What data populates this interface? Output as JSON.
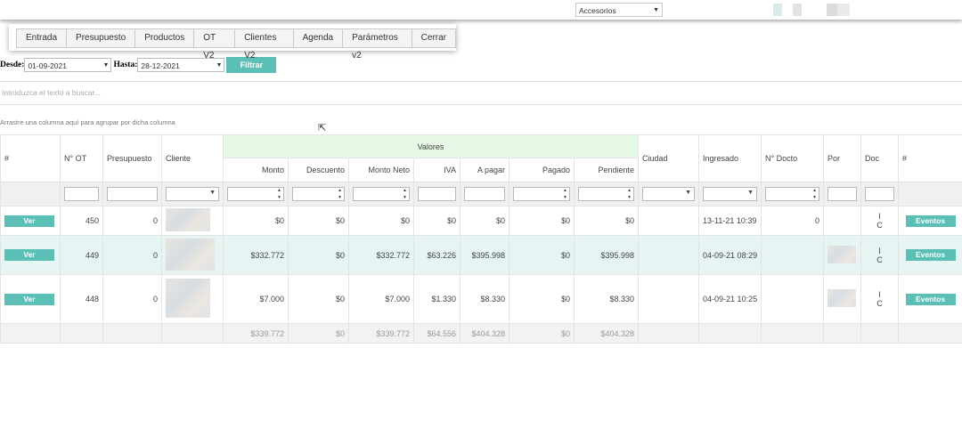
{
  "topbar": {
    "category": "Accesorios"
  },
  "menu": [
    "Entrada",
    "Presupuesto",
    "Productos",
    "OT V2",
    "Clientes V2",
    "Agenda",
    "Parámetros v2",
    "Cerrar"
  ],
  "filter": {
    "desde_label": "Desde:",
    "desde_value": "01-09-2021",
    "hasta_label": "Hasta:",
    "hasta_value": "28-12-2021",
    "button": "Filtrar"
  },
  "search_placeholder": "Introduzca el texto a buscar...",
  "group_hint": "Arrastre una columna aquí para agrupar por dicha columna",
  "headers": {
    "hash": "#",
    "ot": "N° OT",
    "presupuesto": "Presupuesto",
    "cliente": "Cliente",
    "valores": "Valores",
    "monto": "Monto",
    "descuento": "Descuento",
    "monto_neto": "Monto Neto",
    "iva": "IVA",
    "a_pagar": "A pagar",
    "pagado": "Pagado",
    "pendiente": "Pendiente",
    "ciudad": "Ciudad",
    "ingresado": "Ingresado",
    "n_docto": "N° Docto",
    "por": "Por",
    "doc": "Doc",
    "hash2": "#"
  },
  "rows": [
    {
      "ver": "Ver",
      "ot": "450",
      "presupuesto": "0",
      "monto": "$0",
      "descuento": "$0",
      "monto_neto": "$0",
      "iva": "$0",
      "a_pagar": "$0",
      "pagado": "$0",
      "pendiente": "$0",
      "ciudad": "",
      "ingresado": "13-11-21 10:39",
      "n_docto": "0",
      "doc": "I\nC",
      "eventos": "Eventos"
    },
    {
      "ver": "Ver",
      "ot": "449",
      "presupuesto": "0",
      "monto": "$332.772",
      "descuento": "$0",
      "monto_neto": "$332.772",
      "iva": "$63.226",
      "a_pagar": "$395.998",
      "pagado": "$0",
      "pendiente": "$395.998",
      "ciudad": "",
      "ingresado": "04-09-21 08:29",
      "n_docto": "",
      "doc": "I\nC",
      "eventos": "Eventos"
    },
    {
      "ver": "Ver",
      "ot": "448",
      "presupuesto": "0",
      "monto": "$7.000",
      "descuento": "$0",
      "monto_neto": "$7.000",
      "iva": "$1.330",
      "a_pagar": "$8.330",
      "pagado": "$0",
      "pendiente": "$8.330",
      "ciudad": "",
      "ingresado": "04-09-21 10:25",
      "n_docto": "",
      "doc": "I\nC",
      "eventos": "Eventos"
    }
  ],
  "totals": {
    "monto": "$339.772",
    "descuento": "$0",
    "monto_neto": "$339.772",
    "iva": "$64.556",
    "a_pagar": "$404.328",
    "pagado": "$0",
    "pendiente": "$404.328"
  },
  "colors": {
    "accent": "#5bbfb5",
    "valores_bg": "#e6f8e6",
    "highlight_row": "#e6f4f3"
  }
}
